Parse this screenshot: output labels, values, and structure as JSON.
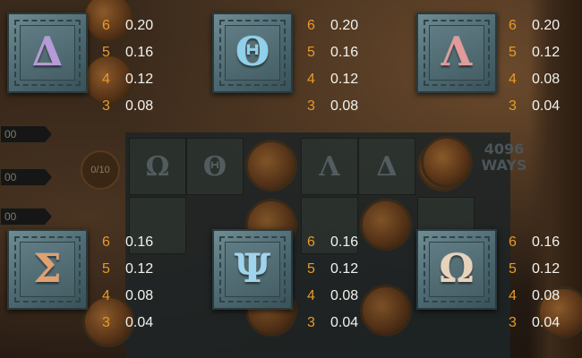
{
  "theme": {
    "count_color": "#e89a28",
    "value_color": "#f2f2ee"
  },
  "background": {
    "reel_symbols": [
      "Ω",
      "Θ",
      "Λ",
      "Δ"
    ],
    "ways_text": "4096 WAYS",
    "counter_text": "0/10",
    "side_bars": [
      "00",
      "00",
      "00"
    ]
  },
  "paytable": [
    {
      "symbol": "Δ",
      "symbol_name": "delta",
      "color": "#b79ad8",
      "payouts": [
        {
          "count": "6",
          "value": "0.20"
        },
        {
          "count": "5",
          "value": "0.16"
        },
        {
          "count": "4",
          "value": "0.12"
        },
        {
          "count": "3",
          "value": "0.08"
        }
      ]
    },
    {
      "symbol": "Θ",
      "symbol_name": "theta",
      "color": "#8fd0ea",
      "payouts": [
        {
          "count": "6",
          "value": "0.20"
        },
        {
          "count": "5",
          "value": "0.16"
        },
        {
          "count": "4",
          "value": "0.12"
        },
        {
          "count": "3",
          "value": "0.08"
        }
      ]
    },
    {
      "symbol": "Λ",
      "symbol_name": "lambda",
      "color": "#e29a9a",
      "payouts": [
        {
          "count": "6",
          "value": "0.20"
        },
        {
          "count": "5",
          "value": "0.12"
        },
        {
          "count": "4",
          "value": "0.08"
        },
        {
          "count": "3",
          "value": "0.04"
        }
      ]
    },
    {
      "symbol": "Σ",
      "symbol_name": "sigma",
      "color": "#e0a070",
      "payouts": [
        {
          "count": "6",
          "value": "0.16"
        },
        {
          "count": "5",
          "value": "0.12"
        },
        {
          "count": "4",
          "value": "0.08"
        },
        {
          "count": "3",
          "value": "0.04"
        }
      ]
    },
    {
      "symbol": "Ψ",
      "symbol_name": "psi",
      "color": "#9fd4ee",
      "payouts": [
        {
          "count": "6",
          "value": "0.16"
        },
        {
          "count": "5",
          "value": "0.12"
        },
        {
          "count": "4",
          "value": "0.08"
        },
        {
          "count": "3",
          "value": "0.04"
        }
      ]
    },
    {
      "symbol": "Ω",
      "symbol_name": "omega",
      "color": "#e8d2bc",
      "payouts": [
        {
          "count": "6",
          "value": "0.16"
        },
        {
          "count": "5",
          "value": "0.12"
        },
        {
          "count": "4",
          "value": "0.08"
        },
        {
          "count": "3",
          "value": "0.04"
        }
      ]
    }
  ]
}
